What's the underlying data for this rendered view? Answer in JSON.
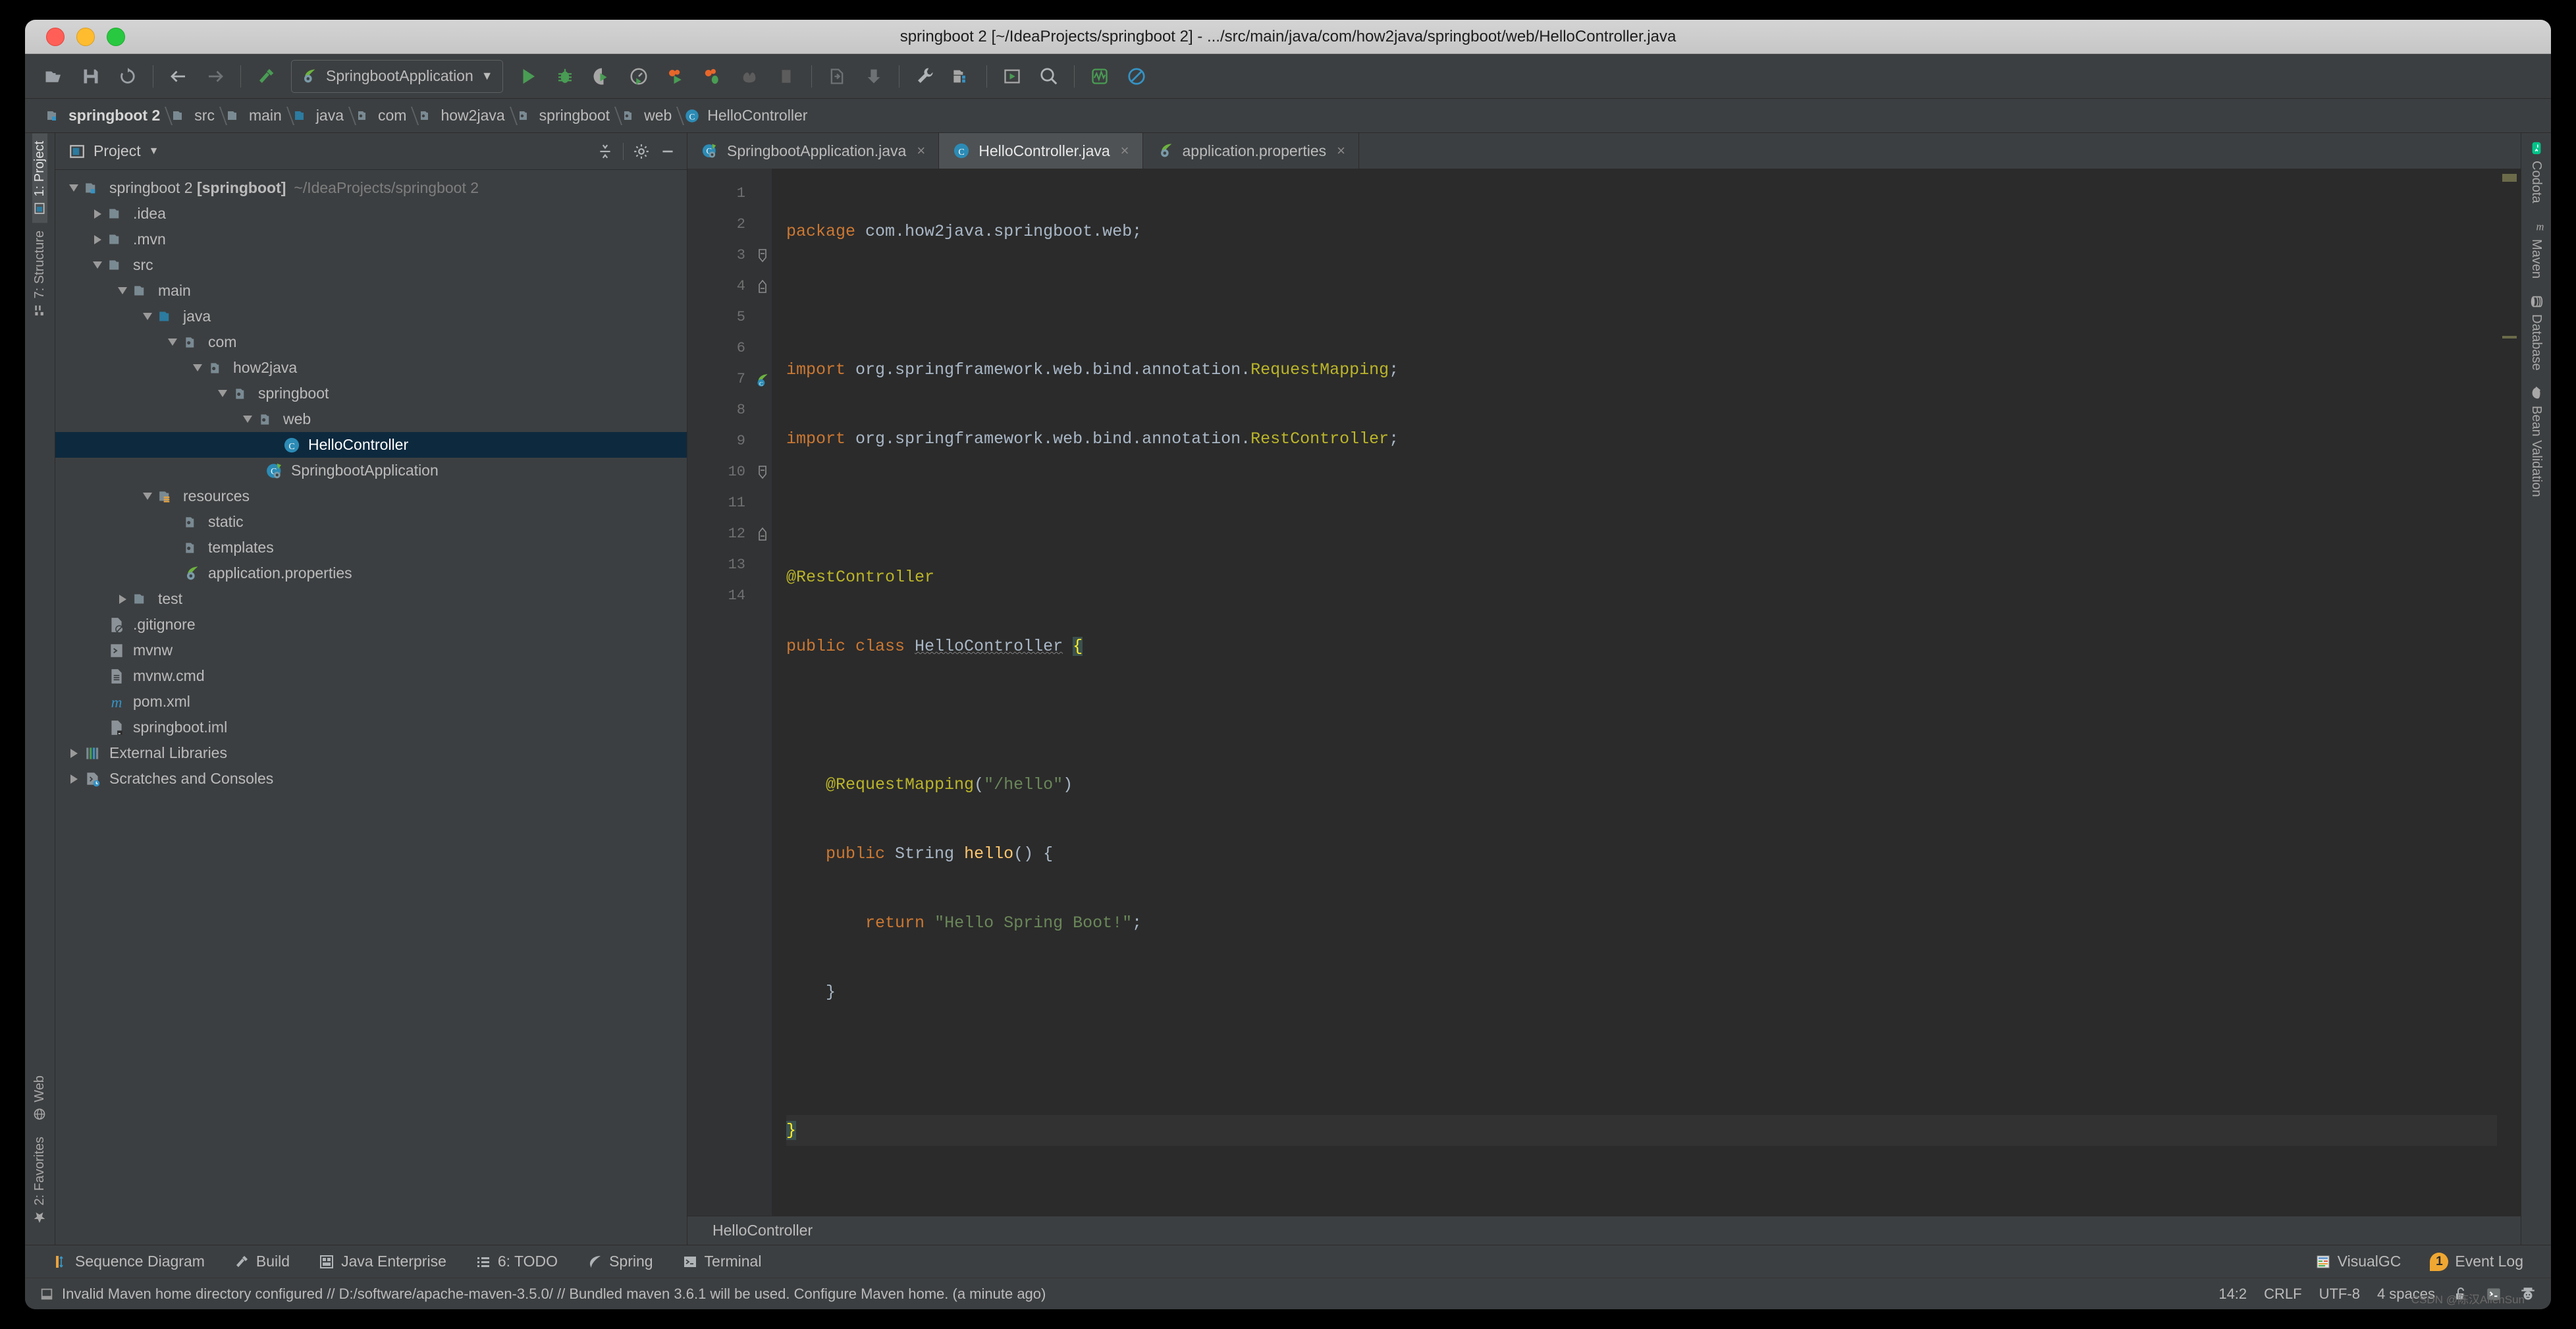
{
  "window": {
    "title": "springboot 2 [~/IdeaProjects/springboot 2] - .../src/main/java/com/how2java/springboot/web/HelloController.java"
  },
  "toolbar": {
    "run_config_label": "SpringbootApplication",
    "icons": [
      "open-folder-icon",
      "save-icon",
      "sync-icon",
      "back-arrow-icon",
      "forward-arrow-icon",
      "build-hammer-icon",
      "run-icon",
      "debug-icon",
      "run-coverage-icon",
      "profile-icon",
      "spring-run-icon",
      "spring-debug-icon",
      "stop-icon",
      "rerun-icon",
      "update-app-icon",
      "export-icon",
      "settings-wrench-icon",
      "project-structure-icon",
      "run-anything-icon",
      "search-icon",
      "visualgc-icon",
      "no-entry-icon"
    ]
  },
  "breadcrumb": [
    {
      "label": "springboot 2",
      "icon": "module-folder-icon"
    },
    {
      "label": "src",
      "icon": "folder-icon"
    },
    {
      "label": "main",
      "icon": "folder-icon"
    },
    {
      "label": "java",
      "icon": "source-folder-icon"
    },
    {
      "label": "com",
      "icon": "package-icon"
    },
    {
      "label": "how2java",
      "icon": "package-icon"
    },
    {
      "label": "springboot",
      "icon": "package-icon"
    },
    {
      "label": "web",
      "icon": "package-icon"
    },
    {
      "label": "HelloController",
      "icon": "class-icon"
    }
  ],
  "left_sidebar": {
    "top": [
      {
        "label": "1: Project",
        "icon": "project-icon",
        "active": true
      },
      {
        "label": "7: Structure",
        "icon": "structure-icon",
        "active": false
      }
    ],
    "bottom": [
      {
        "label": "Web",
        "icon": "web-icon",
        "active": false
      },
      {
        "label": "2: Favorites",
        "icon": "star-icon",
        "active": false
      }
    ]
  },
  "right_sidebar": [
    {
      "label": "Codota",
      "icon": "codota-icon"
    },
    {
      "label": "Maven",
      "icon": "maven-icon"
    },
    {
      "label": "Database",
      "icon": "database-icon"
    },
    {
      "label": "Bean Validation",
      "icon": "bean-validation-icon"
    }
  ],
  "project_panel": {
    "title": "Project",
    "actions": [
      "collapse-all-icon",
      "settings-gear-icon",
      "hide-panel-icon"
    ],
    "tree": [
      {
        "indent": 0,
        "twisty": "down",
        "icon": "module-folder-icon",
        "label": "springboot 2 [springboot]",
        "suffix": "~/IdeaProjects/springboot 2",
        "bold_part": "[springboot]",
        "selected": false
      },
      {
        "indent": 1,
        "twisty": "right",
        "icon": "folder-icon",
        "label": ".idea",
        "selected": false
      },
      {
        "indent": 1,
        "twisty": "right",
        "icon": "folder-icon",
        "label": ".mvn",
        "selected": false
      },
      {
        "indent": 1,
        "twisty": "down",
        "icon": "folder-icon",
        "label": "src",
        "selected": false
      },
      {
        "indent": 2,
        "twisty": "down",
        "icon": "folder-icon",
        "label": "main",
        "selected": false
      },
      {
        "indent": 3,
        "twisty": "down",
        "icon": "source-folder-icon",
        "label": "java",
        "selected": false
      },
      {
        "indent": 4,
        "twisty": "down",
        "icon": "package-icon",
        "label": "com",
        "selected": false
      },
      {
        "indent": 5,
        "twisty": "down",
        "icon": "package-icon",
        "label": "how2java",
        "selected": false
      },
      {
        "indent": 6,
        "twisty": "down",
        "icon": "package-icon",
        "label": "springboot",
        "selected": false
      },
      {
        "indent": 7,
        "twisty": "down",
        "icon": "package-icon",
        "label": "web",
        "selected": false
      },
      {
        "indent": 8,
        "twisty": "none",
        "icon": "class-icon",
        "label": "HelloController",
        "selected": true
      },
      {
        "indent": 7,
        "twisty": "none",
        "icon": "spring-class-icon",
        "label": "SpringbootApplication",
        "selected": false
      },
      {
        "indent": 3,
        "twisty": "down",
        "icon": "resources-folder-icon",
        "label": "resources",
        "selected": false
      },
      {
        "indent": 4,
        "twisty": "none",
        "icon": "package-icon",
        "label": "static",
        "selected": false
      },
      {
        "indent": 4,
        "twisty": "none",
        "icon": "package-icon",
        "label": "templates",
        "selected": false
      },
      {
        "indent": 4,
        "twisty": "none",
        "icon": "spring-leaf-icon",
        "label": "application.properties",
        "selected": false
      },
      {
        "indent": 2,
        "twisty": "right",
        "icon": "folder-icon",
        "label": "test",
        "selected": false
      },
      {
        "indent": 1,
        "twisty": "none",
        "icon": "gitignore-icon",
        "label": ".gitignore",
        "selected": false
      },
      {
        "indent": 1,
        "twisty": "none",
        "icon": "shell-file-icon",
        "label": "mvnw",
        "selected": false
      },
      {
        "indent": 1,
        "twisty": "none",
        "icon": "cmd-file-icon",
        "label": "mvnw.cmd",
        "selected": false
      },
      {
        "indent": 1,
        "twisty": "none",
        "icon": "maven-pom-icon",
        "label": "pom.xml",
        "selected": false
      },
      {
        "indent": 1,
        "twisty": "none",
        "icon": "iml-file-icon",
        "label": "springboot.iml",
        "selected": false
      },
      {
        "indent": 0,
        "twisty": "right",
        "icon": "external-libraries-icon",
        "label": "External Libraries",
        "selected": false
      },
      {
        "indent": 0,
        "twisty": "right",
        "icon": "scratches-icon",
        "label": "Scratches and Consoles",
        "selected": false
      }
    ]
  },
  "editor": {
    "tabs": [
      {
        "label": "SpringbootApplication.java",
        "icon": "spring-class-icon",
        "active": false,
        "close": "×"
      },
      {
        "label": "HelloController.java",
        "icon": "class-icon",
        "active": true,
        "close": "×"
      },
      {
        "label": "application.properties",
        "icon": "spring-leaf-icon",
        "active": false,
        "close": "×"
      }
    ],
    "line_numbers": [
      "1",
      "2",
      "3",
      "4",
      "5",
      "6",
      "7",
      "8",
      "9",
      "10",
      "11",
      "12",
      "13",
      "14"
    ],
    "code_lines": [
      {
        "n": 1,
        "text": "package com.how2java.springboot.web;"
      },
      {
        "n": 2,
        "text": ""
      },
      {
        "n": 3,
        "text": "import org.springframework.web.bind.annotation.RequestMapping;"
      },
      {
        "n": 4,
        "text": "import org.springframework.web.bind.annotation.RestController;"
      },
      {
        "n": 5,
        "text": ""
      },
      {
        "n": 6,
        "text": "@RestController"
      },
      {
        "n": 7,
        "text": "public class HelloController {"
      },
      {
        "n": 8,
        "text": ""
      },
      {
        "n": 9,
        "text": "    @RequestMapping(\"/hello\")"
      },
      {
        "n": 10,
        "text": "    public String hello() {"
      },
      {
        "n": 11,
        "text": "        return \"Hello Spring Boot!\";"
      },
      {
        "n": 12,
        "text": "    }"
      },
      {
        "n": 13,
        "text": ""
      },
      {
        "n": 14,
        "text": "}"
      }
    ],
    "breadcrumb_status": "HelloController"
  },
  "tool_windows": [
    {
      "label": "Sequence Diagram",
      "icon": "sequence-diagram-icon"
    },
    {
      "label": "Build",
      "icon": "build-icon"
    },
    {
      "label": "Java Enterprise",
      "icon": "java-enterprise-icon"
    },
    {
      "label": "6: TODO",
      "icon": "todo-icon"
    },
    {
      "label": "Spring",
      "icon": "spring-leaf-icon"
    },
    {
      "label": "Terminal",
      "icon": "terminal-icon"
    }
  ],
  "tool_windows_right": [
    {
      "label": "VisualGC",
      "icon": "visualgc-icon"
    },
    {
      "label": "Event Log",
      "icon": "event-log-icon",
      "badge": "1"
    }
  ],
  "status_bar": {
    "message": "Invalid Maven home directory configured // D:/software/apache-maven-3.5.0/ // Bundled maven 3.6.1 will be used.  Configure Maven home.  (a minute ago)",
    "caret_position": "14:2",
    "line_separator": "CRLF",
    "encoding": "UTF-8",
    "indent": "4 spaces",
    "icons": [
      "lock-open-icon",
      "terminal-icon",
      "hector-icon"
    ]
  },
  "watermark": "CSDN @陈汉AllenSun",
  "colors": {
    "accent_blue": "#3592c4",
    "keyword_orange": "#cc7832",
    "annotation_yellow": "#bbb529",
    "string_green": "#6a8759",
    "method_gold": "#ffc66d",
    "selection_navy": "#0d293e",
    "editor_bg": "#2b2b2b",
    "chrome_bg": "#3c3f41"
  }
}
